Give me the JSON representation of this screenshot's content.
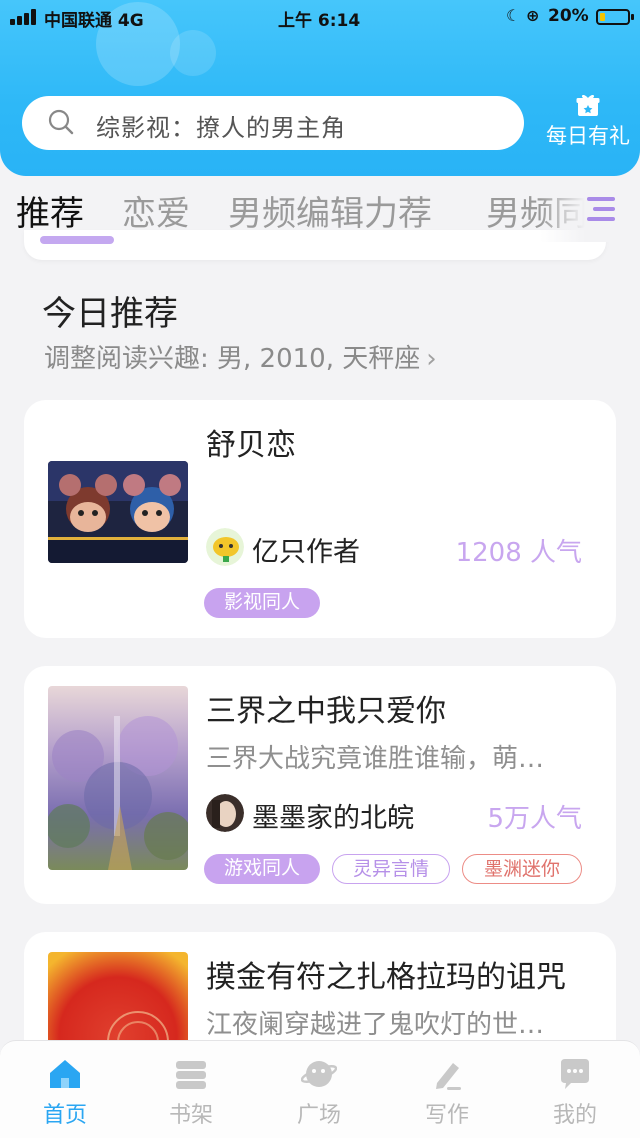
{
  "status_bar": {
    "carrier": "中国联通  4G",
    "time": "上午 6:14",
    "battery_percent": "20%",
    "battery_level": 0.2
  },
  "header": {
    "search_placeholder": "综影视：撩人的男主角",
    "gift_label": "每日有礼"
  },
  "tabs": [
    {
      "label": "推荐",
      "active": true
    },
    {
      "label": "恋爱",
      "active": false
    },
    {
      "label": "男频编辑力荐",
      "active": false
    },
    {
      "label": "男频同",
      "active": false
    }
  ],
  "section": {
    "title": "今日推荐",
    "subtitle": "调整阅读兴趣: 男, 2010, 天秤座"
  },
  "books": [
    {
      "title": "舒贝恋",
      "description": "",
      "author": "亿只作者",
      "popularity": "1208 人气",
      "tags": [
        "影视同人"
      ]
    },
    {
      "title": "三界之中我只爱你",
      "description": "三界大战究竟谁胜谁输，萌…",
      "author": "墨墨家的北皖",
      "popularity": "5万人气",
      "tags": [
        "游戏同人",
        "灵异言情",
        "墨渊迷你"
      ]
    },
    {
      "title": "摸金有符之扎格拉玛的诅咒",
      "description": "江夜阑穿越进了鬼吹灯的世…",
      "author": "",
      "popularity": "",
      "tags": []
    }
  ],
  "bottom_nav": [
    {
      "label": "首页",
      "active": true,
      "icon": "home-icon"
    },
    {
      "label": "书架",
      "active": false,
      "icon": "bookshelf-icon"
    },
    {
      "label": "广场",
      "active": false,
      "icon": "plaza-icon"
    },
    {
      "label": "写作",
      "active": false,
      "icon": "pen-icon"
    },
    {
      "label": "我的",
      "active": false,
      "icon": "profile-icon"
    }
  ],
  "colors": {
    "header_blue": "#2eb8f7",
    "accent_purple": "#c8a3ef",
    "tag_red": "#e0736d",
    "nav_active": "#2aa6f2"
  }
}
